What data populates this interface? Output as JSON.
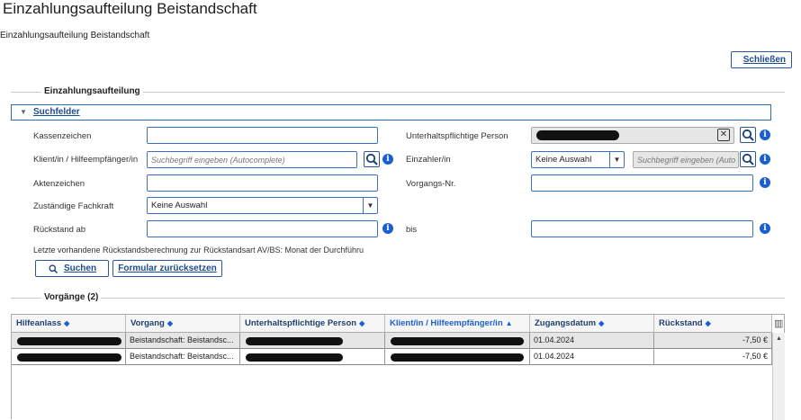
{
  "window": {
    "title": "Einzahlungsaufteilung Beistandschaft"
  },
  "breadcrumb": "Einzahlungsaufteilung Beistandschaft",
  "close_button": "Schließen",
  "section_einzahlung": "Einzahlungsaufteilung",
  "suchfelder": {
    "toggle_label": "Suchfelder"
  },
  "fields": {
    "kassenzeichen": {
      "label": "Kassenzeichen",
      "value": ""
    },
    "klient": {
      "label": "Klient/in / Hilfeempfänger/in",
      "placeholder": "Suchbegriff eingeben (Autocomplete)"
    },
    "aktenzeichen": {
      "label": "Aktenzeichen",
      "value": ""
    },
    "fachkraft": {
      "label": "Zuständige Fachkraft",
      "selected": "Keine Auswahl"
    },
    "rueckstand_ab": {
      "label": "Rückstand ab",
      "value": ""
    },
    "unterhaltspflichtige": {
      "label": "Unterhaltspflichtige Person"
    },
    "einzahler": {
      "label": "Einzahler/in",
      "selected": "Keine Auswahl",
      "placeholder": "Suchbegriff eingeben (Auto"
    },
    "vorgangs_nr": {
      "label": "Vorgangs-Nr.",
      "value": ""
    },
    "bis": {
      "label": "bis",
      "value": ""
    }
  },
  "note": "Letzte vorhandene Rückstandsberechnung zur Rückstandsart AV/BS:  Monat der Durchführu",
  "buttons": {
    "search": "Suchen",
    "reset": "Formular zurücksetzen"
  },
  "vorgaenge": {
    "label": "Vorgänge (2)"
  },
  "table": {
    "columns": [
      "Hilfeanlass",
      "Vorgang",
      "Unterhaltspflichtige Person",
      "Klient/in / Hilfeempfänger/in",
      "Zugangsdatum",
      "Rückstand"
    ],
    "rows": [
      {
        "vorgang": "Beistandschaft: Beistandsc...",
        "zugangsdatum": "01.04.2024",
        "rueckstand": "-7,50 €"
      },
      {
        "vorgang": "Beistandschaft: Beistandsc...",
        "zugangsdatum": "01.04.2024",
        "rueckstand": "-7,50 €"
      }
    ]
  },
  "icons": {
    "search": "search-icon",
    "clear": "clear-icon",
    "info": "info-icon",
    "dropdown": "chevron-down-icon",
    "expand": "triangle-down-icon",
    "column_settings": "column-settings-icon"
  }
}
